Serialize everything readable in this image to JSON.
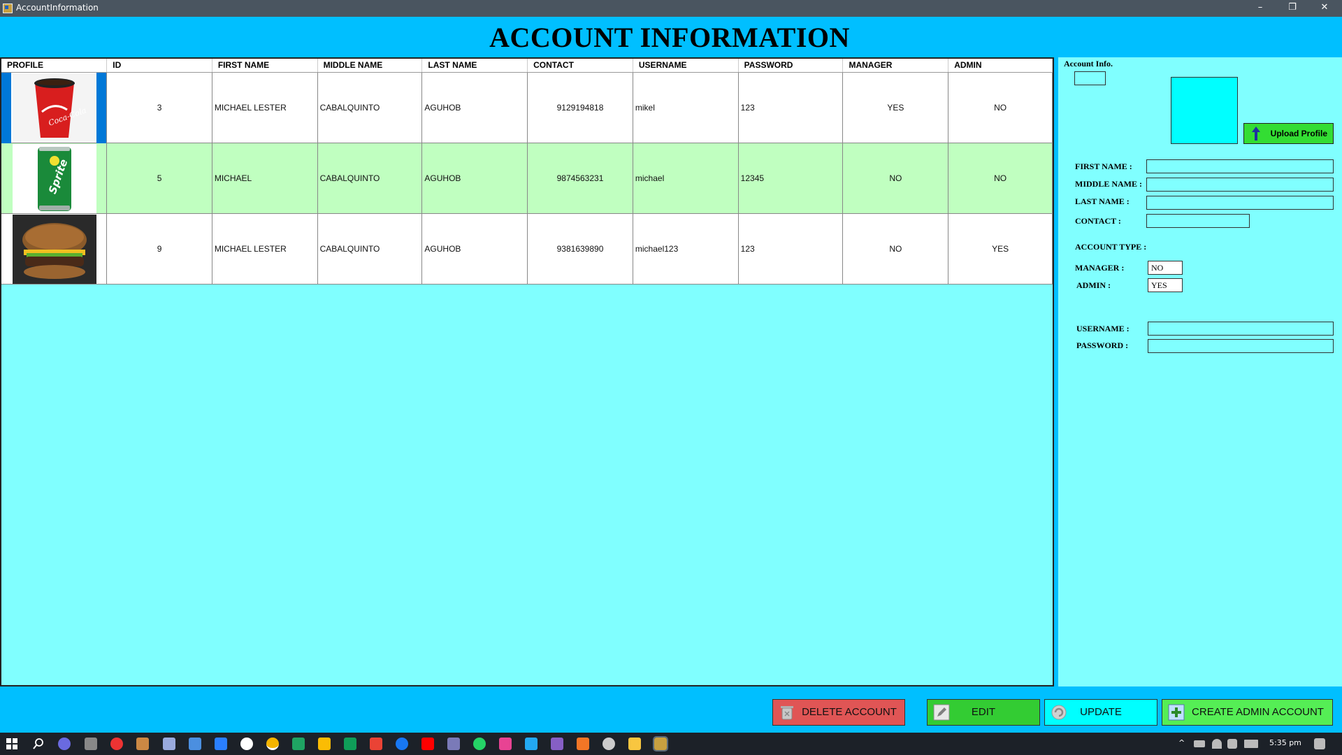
{
  "window": {
    "title": "AccountInformation",
    "minimize": "–",
    "restore": "❐",
    "close": "✕"
  },
  "header": {
    "title": "ACCOUNT INFORMATION"
  },
  "grid": {
    "columns": [
      "PROFILE",
      "ID",
      "FIRST NAME",
      "MIDDLE NAME",
      "LAST NAME",
      "CONTACT",
      "USERNAME",
      "PASSWORD",
      "MANAGER",
      "ADMIN"
    ],
    "rows": [
      {
        "profile": "coca-cola-cup",
        "id": "3",
        "first": "MICHAEL LESTER",
        "middle": "CABALQUINTO",
        "last": "AGUHOB",
        "contact": "9129194818",
        "username": "mikel",
        "password": "123",
        "manager": "YES",
        "admin": "NO"
      },
      {
        "profile": "sprite-can",
        "id": "5",
        "first": "MICHAEL",
        "middle": "CABALQUINTO",
        "last": "AGUHOB",
        "contact": "9874563231",
        "username": "michael",
        "password": "12345",
        "manager": "NO",
        "admin": "NO"
      },
      {
        "profile": "burger",
        "id": "9",
        "first": "MICHAEL LESTER",
        "middle": "CABALQUINTO",
        "last": "AGUHOB",
        "contact": "9381639890",
        "username": "michael123",
        "password": "123",
        "manager": "NO",
        "admin": "YES"
      }
    ]
  },
  "panel": {
    "title": "Account Info.",
    "id_value": "",
    "upload_label": "Upload Profile",
    "first_name_label": "FIRST NAME :",
    "middle_name_label": "MIDDLE NAME :",
    "last_name_label": "LAST NAME :",
    "contact_label": "CONTACT :",
    "account_type_label": "ACCOUNT TYPE :",
    "manager_label": "MANAGER :",
    "manager_value": "NO",
    "admin_label": "ADMIN :",
    "admin_value": "YES",
    "username_label": "USERNAME :",
    "password_label": "PASSWORD :",
    "first_name_value": "",
    "middle_name_value": "",
    "last_name_value": "",
    "contact_value": "",
    "username_value": "",
    "password_value": ""
  },
  "footer": {
    "delete_label": "DELETE ACCOUNT",
    "edit_label": "EDIT",
    "update_label": "UPDATE",
    "create_label": "CREATE ADMIN ACCOUNT"
  },
  "taskbar": {
    "time": "5:35 pm"
  },
  "colors": {
    "header": "#00bfff",
    "grid_bg": "#80ffff",
    "selected_row": "#c0ffc0",
    "selection_bar": "#0078d7",
    "delete": "#e05555",
    "edit": "#33cc33",
    "update": "#00ffff",
    "create": "#55ee55"
  }
}
